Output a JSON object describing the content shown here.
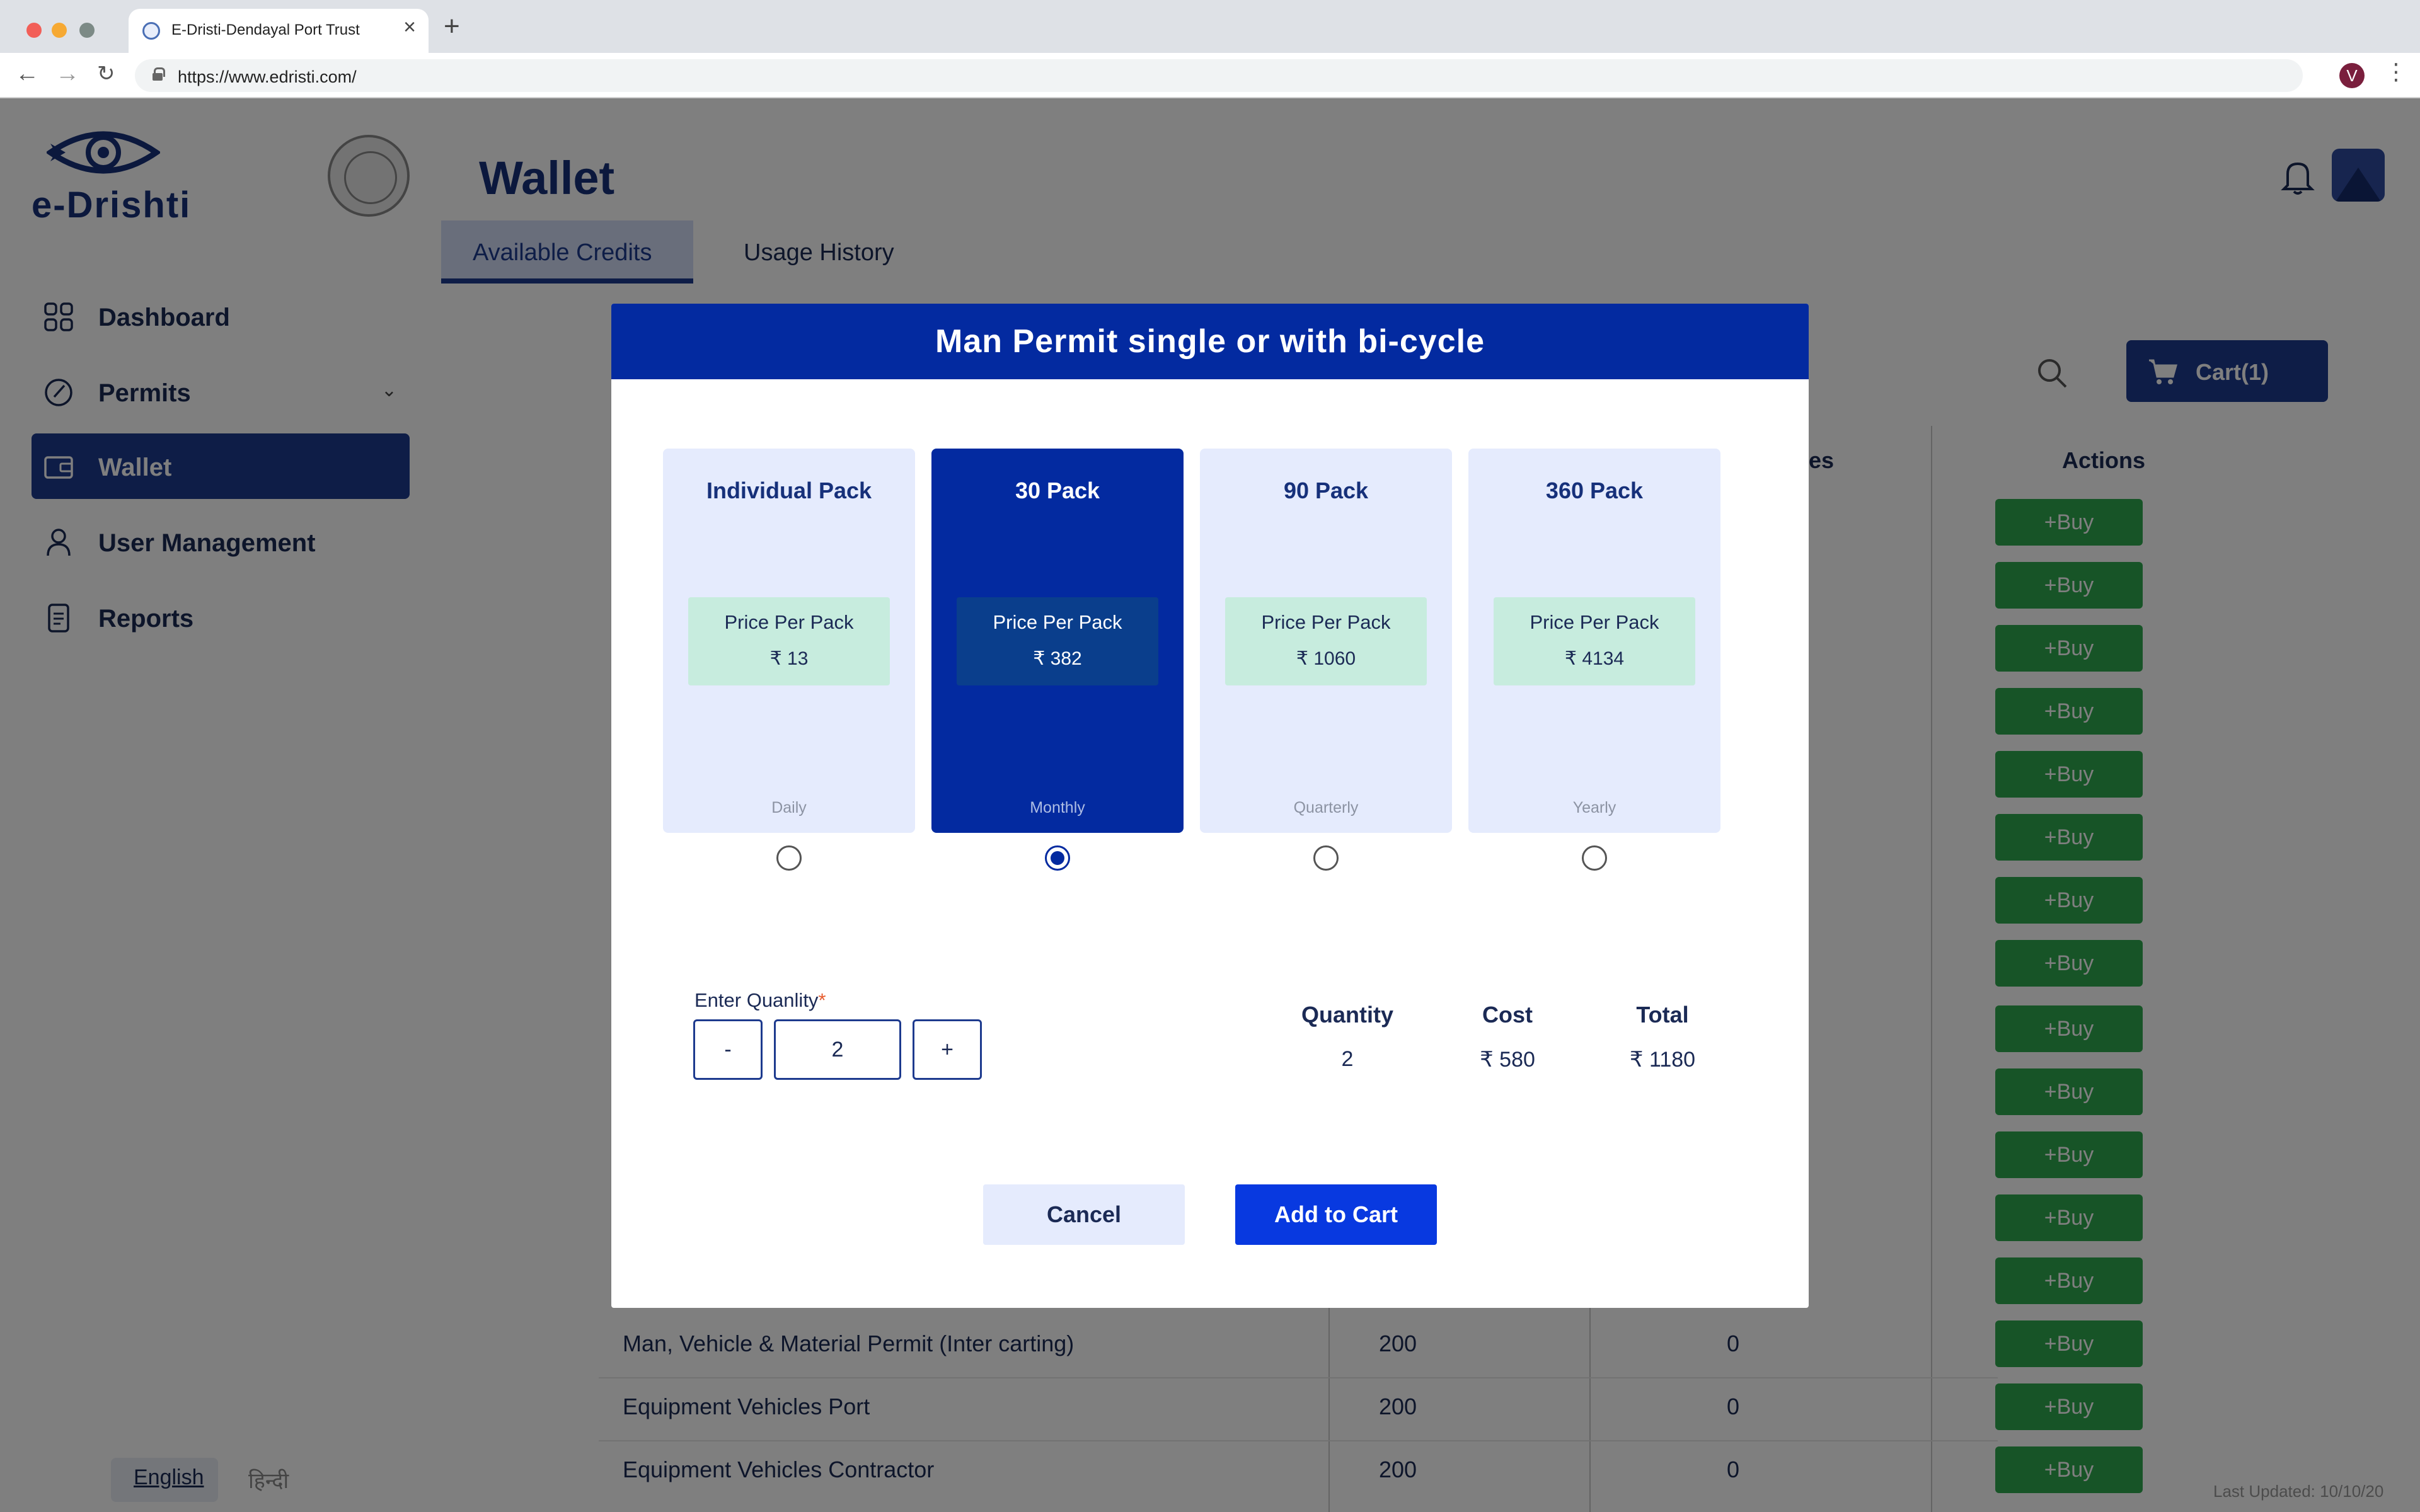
{
  "browser": {
    "tab_title": "E-Dristi-Dendayal Port Trust",
    "url": "https://www.edristi.com/",
    "profile_initial": "V",
    "icons": [
      "back-icon",
      "forward-icon",
      "reload-icon",
      "lock-icon",
      "close-icon",
      "plus-icon",
      "kebab-menu-icon"
    ]
  },
  "sidebar": {
    "logo_text": "e-Drishti",
    "items": [
      {
        "label": "Dashboard",
        "icon": "grid-icon"
      },
      {
        "label": "Permits",
        "icon": "permit-icon"
      },
      {
        "label": "Wallet",
        "icon": "wallet-icon",
        "active": true
      },
      {
        "label": "User Management",
        "icon": "user-icon"
      },
      {
        "label": "Reports",
        "icon": "report-icon"
      }
    ],
    "lang_english": "English",
    "lang_hindi": "हिन्दी"
  },
  "main": {
    "title": "Wallet",
    "tabs": [
      "Available Credits",
      "Usage History"
    ],
    "cart_label": "Cart(1)",
    "col_uses_partial": "ses",
    "col_actions": "Actions",
    "buy_label": "+Buy",
    "rows": [
      {
        "name": "Man, Vehicle & Material Permit (Inter carting)",
        "a": "200",
        "b": "0"
      },
      {
        "name": "Equipment Vehicles Port",
        "a": "200",
        "b": "0"
      },
      {
        "name": "Equipment Vehicles Contractor",
        "a": "200",
        "b": "0"
      }
    ],
    "last_updated": "Last Updated: 10/10/20"
  },
  "modal": {
    "title": "Man Permit single or with bi-cycle",
    "price_label": "Price Per Pack",
    "packs": [
      {
        "name": "Individual Pack",
        "price": "₹ 13",
        "period": "Daily",
        "selected": false
      },
      {
        "name": "30 Pack",
        "price": "₹ 382",
        "period": "Monthly",
        "selected": true
      },
      {
        "name": "90 Pack",
        "price": "₹ 1060",
        "period": "Quarterly",
        "selected": false
      },
      {
        "name": "360 Pack",
        "price": "₹ 4134",
        "period": "Yearly",
        "selected": false
      }
    ],
    "qty_label": "Enter Quanlity",
    "qty_required": "*",
    "minus": "-",
    "plus": "+",
    "qty_value": "2",
    "summary": {
      "quantity_head": "Quantity",
      "quantity_val": "2",
      "cost_head": "Cost",
      "cost_val": "₹ 580",
      "total_head": "Total",
      "total_val": "₹ 1180"
    },
    "cancel_label": "Cancel",
    "add_label": "Add to Cart"
  },
  "colors": {
    "brand_navy": "#1d3a8e",
    "modal_header": "#032aa0",
    "card_bg": "#e5ebfd",
    "price_bg": "#c7ecde",
    "buy_green": "#2fa84f",
    "add_button": "#0839e0"
  }
}
